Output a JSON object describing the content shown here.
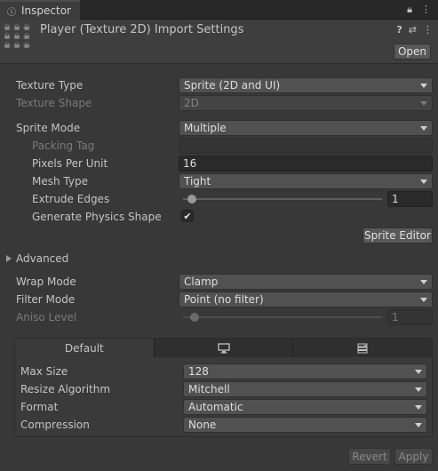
{
  "window": {
    "tab_title": "Inspector",
    "tab_icon": "info-icon",
    "tab_actions": [
      "lock-icon",
      "menu-icon"
    ]
  },
  "header": {
    "title": "Player (Texture 2D) Import Settings",
    "open_label": "Open",
    "icons": [
      "help-icon",
      "presets-icon",
      "more-icon"
    ]
  },
  "fields": {
    "texture_type": {
      "label": "Texture Type",
      "value": "Sprite (2D and UI)"
    },
    "texture_shape": {
      "label": "Texture Shape",
      "value": "2D"
    },
    "sprite_mode": {
      "label": "Sprite Mode",
      "value": "Multiple"
    },
    "packing_tag": {
      "label": "Packing Tag",
      "value": ""
    },
    "pixels_per_unit": {
      "label": "Pixels Per Unit",
      "value": "16"
    },
    "mesh_type": {
      "label": "Mesh Type",
      "value": "Tight"
    },
    "extrude_edges": {
      "label": "Extrude Edges",
      "value": "1"
    },
    "generate_physics_shape": {
      "label": "Generate Physics Shape",
      "checked": true,
      "glyph": "✔"
    },
    "sprite_editor_label": "Sprite Editor",
    "advanced_label": "Advanced",
    "wrap_mode": {
      "label": "Wrap Mode",
      "value": "Clamp"
    },
    "filter_mode": {
      "label": "Filter Mode",
      "value": "Point (no filter)"
    },
    "aniso_level": {
      "label": "Aniso Level",
      "value": "1"
    }
  },
  "platform": {
    "tabs": [
      {
        "label": "Default",
        "icon": ""
      },
      {
        "label": "",
        "icon": "monitor-icon"
      },
      {
        "label": "",
        "icon": "server-icon"
      }
    ],
    "max_size": {
      "label": "Max Size",
      "value": "128"
    },
    "resize_algorithm": {
      "label": "Resize Algorithm",
      "value": "Mitchell"
    },
    "format": {
      "label": "Format",
      "value": "Automatic"
    },
    "compression": {
      "label": "Compression",
      "value": "None"
    }
  },
  "footer": {
    "revert_label": "Revert",
    "apply_label": "Apply"
  }
}
